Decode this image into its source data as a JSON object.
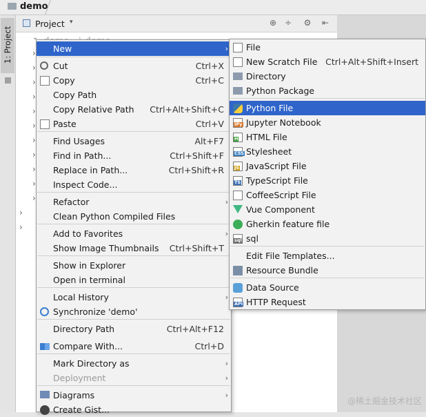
{
  "topbar": {
    "title": "demo"
  },
  "sidebar": {
    "tab_label": "1: Project"
  },
  "panel": {
    "header_label": "Project",
    "dropdown_glyph": "▾",
    "tool_icons": [
      "⊕",
      "÷",
      "⚙",
      "⇤"
    ]
  },
  "tree": {
    "root_faded": "demo  ~\\ demo"
  },
  "context_menu": {
    "items": [
      {
        "label": "New",
        "shortcut": "",
        "submenu": true,
        "selected": true
      },
      {
        "label": "Cut",
        "shortcut": "Ctrl+X",
        "icon": "scissors-icon"
      },
      {
        "label": "Copy",
        "shortcut": "Ctrl+C",
        "icon": "copy-icon"
      },
      {
        "label": "Copy Path",
        "shortcut": ""
      },
      {
        "label": "Copy Relative Path",
        "shortcut": "Ctrl+Alt+Shift+C"
      },
      {
        "label": "Paste",
        "shortcut": "Ctrl+V",
        "icon": "paste-icon"
      },
      {
        "label": "Find Usages",
        "shortcut": "Alt+F7"
      },
      {
        "label": "Find in Path...",
        "shortcut": "Ctrl+Shift+F"
      },
      {
        "label": "Replace in Path...",
        "shortcut": "Ctrl+Shift+R"
      },
      {
        "label": "Inspect Code...",
        "shortcut": ""
      },
      {
        "label": "Refactor",
        "shortcut": "",
        "submenu": true
      },
      {
        "label": "Clean Python Compiled Files",
        "shortcut": ""
      },
      {
        "label": "Add to Favorites",
        "shortcut": "",
        "submenu": true
      },
      {
        "label": "Show Image Thumbnails",
        "shortcut": "Ctrl+Shift+T"
      },
      {
        "label": "Show in Explorer",
        "shortcut": ""
      },
      {
        "label": "Open in terminal",
        "shortcut": ""
      },
      {
        "label": "Local History",
        "shortcut": "",
        "submenu": true
      },
      {
        "label": "Synchronize 'demo'",
        "shortcut": "",
        "icon": "sync-icon"
      },
      {
        "label": "Directory Path",
        "shortcut": "Ctrl+Alt+F12"
      },
      {
        "label": "Compare With...",
        "shortcut": "Ctrl+D",
        "icon": "compare-icon"
      },
      {
        "label": "Mark Directory as",
        "shortcut": "",
        "submenu": true
      },
      {
        "label": "Deployment",
        "shortcut": "",
        "submenu": true,
        "disabled": true
      },
      {
        "label": "Diagrams",
        "shortcut": "",
        "submenu": true,
        "icon": "diagram-icon"
      },
      {
        "label": "Create Gist...",
        "shortcut": "",
        "icon": "github-icon"
      }
    ]
  },
  "new_submenu": {
    "items": [
      {
        "label": "File",
        "shortcut": "",
        "icon": "file-icon"
      },
      {
        "label": "New Scratch File",
        "shortcut": "Ctrl+Alt+Shift+Insert",
        "icon": "scratch-file-icon"
      },
      {
        "label": "Directory",
        "shortcut": "",
        "icon": "folder-icon"
      },
      {
        "label": "Python Package",
        "shortcut": "",
        "icon": "package-icon"
      },
      {
        "label": "Python File",
        "shortcut": "",
        "icon": "python-icon",
        "selected": true
      },
      {
        "label": "Jupyter Notebook",
        "shortcut": "",
        "icon": "jupyter-icon",
        "badge": "IPy"
      },
      {
        "label": "HTML File",
        "shortcut": "",
        "icon": "html-icon",
        "badge": "H"
      },
      {
        "label": "Stylesheet",
        "shortcut": "",
        "icon": "css-icon",
        "badge": "CSS"
      },
      {
        "label": "JavaScript File",
        "shortcut": "",
        "icon": "js-icon",
        "badge": "JS"
      },
      {
        "label": "TypeScript File",
        "shortcut": "",
        "icon": "ts-icon",
        "badge": "TS"
      },
      {
        "label": "CoffeeScript File",
        "shortcut": "",
        "icon": "coffee-icon"
      },
      {
        "label": "Vue Component",
        "shortcut": "",
        "icon": "vue-icon"
      },
      {
        "label": "Gherkin feature file",
        "shortcut": "",
        "icon": "gherkin-icon"
      },
      {
        "label": "sql",
        "shortcut": "",
        "icon": "sql-icon",
        "badge": "sql"
      },
      {
        "label": "Edit File Templates...",
        "shortcut": ""
      },
      {
        "label": "Resource Bundle",
        "shortcut": "",
        "icon": "resource-bundle-icon"
      },
      {
        "label": "Data Source",
        "shortcut": "",
        "icon": "database-icon"
      },
      {
        "label": "HTTP Request",
        "shortcut": "",
        "icon": "http-request-icon",
        "badge": "API"
      }
    ]
  },
  "colors": {
    "selection": "#2f65ca",
    "menu_bg": "#f2f2f2"
  },
  "watermark": "@稀土掘金技术社区"
}
